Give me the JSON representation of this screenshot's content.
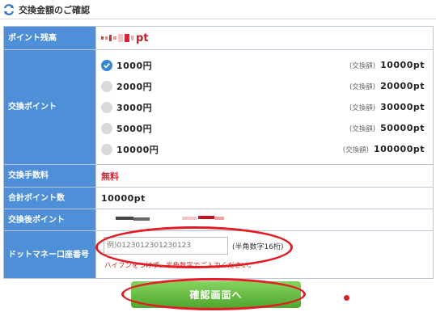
{
  "header": {
    "title": "交換金額のご確認",
    "icon": "exchange-arrows-icon",
    "accent_color": "#3a74c4"
  },
  "balance": {
    "label": "ポイント残高",
    "suffix": "pt"
  },
  "exchange_points": {
    "label": "交換ポイント",
    "exchange_amount_label": "(交換額)",
    "selected_index": 0,
    "options": [
      {
        "amount": "1000円",
        "points": "10000pt",
        "selected": true
      },
      {
        "amount": "2000円",
        "points": "20000pt",
        "selected": false
      },
      {
        "amount": "3000円",
        "points": "30000pt",
        "selected": false
      },
      {
        "amount": "5000円",
        "points": "50000pt",
        "selected": false
      },
      {
        "amount": "10000円",
        "points": "100000pt",
        "selected": false
      }
    ]
  },
  "fee": {
    "label": "交換手数料",
    "value": "無料"
  },
  "total": {
    "label": "合計ポイント数",
    "value": "10000pt"
  },
  "after": {
    "label": "交換後ポイント"
  },
  "account": {
    "label": "ドットマネー口座番号",
    "placeholder": "例)0123012301230123",
    "format_note": "(半角数字16桁)",
    "hint": "ハイフンをつけず、半角数字でご入力ください。"
  },
  "submit": {
    "label": "確認画面へ",
    "color": "#5cb837"
  },
  "colors": {
    "label_bg": "#4e8fd8",
    "highlight_red": "#e31b23",
    "fee_red": "#d8262f"
  }
}
